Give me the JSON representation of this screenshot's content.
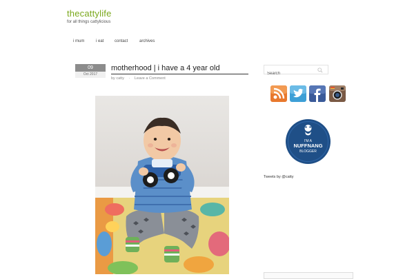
{
  "site": {
    "title": "thecattylife",
    "tagline": "for all things cattylicious",
    "accent_color": "#7aa81c"
  },
  "nav": {
    "items": [
      {
        "label": "i mum"
      },
      {
        "label": "i eat"
      },
      {
        "label": "contact"
      },
      {
        "label": "archives"
      }
    ]
  },
  "post": {
    "date_day": "09",
    "date_month": "Oct 2017",
    "title": "motherhood | i have a 4 year old",
    "author": "by catty",
    "separator": "·",
    "comment_link": "Leave a Comment"
  },
  "sidebar": {
    "search_placeholder": "Search",
    "social_icons": [
      "rss-icon",
      "twitter-icon",
      "facebook-icon",
      "instagram-icon"
    ],
    "badge": {
      "line1": "I'M A",
      "line2": "NUFFNANG",
      "line3": "BLOGGER"
    },
    "tweets_label": "Tweets by @catty"
  }
}
